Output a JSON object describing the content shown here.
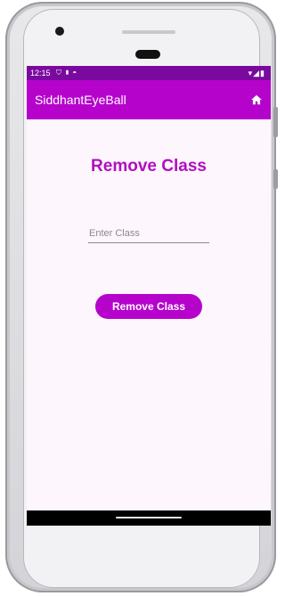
{
  "status_bar": {
    "time": "12:15",
    "left_icons": [
      "shield-icon",
      "sim-icon",
      "circle-icon"
    ],
    "right_icons": [
      "wifi-icon",
      "signal-icon",
      "battery-icon"
    ]
  },
  "app_bar": {
    "title": "SiddhantEyeBall",
    "action_icon": "home-icon",
    "color": "#b503cc"
  },
  "main": {
    "title": "Remove Class",
    "class_input": {
      "value": "",
      "placeholder": "Enter Class"
    },
    "submit_label": "Remove Class"
  },
  "colors": {
    "accent": "#b503cc",
    "status_bar": "#7a0a9e",
    "background": "#fdf6fd",
    "title": "#b00fbf"
  }
}
